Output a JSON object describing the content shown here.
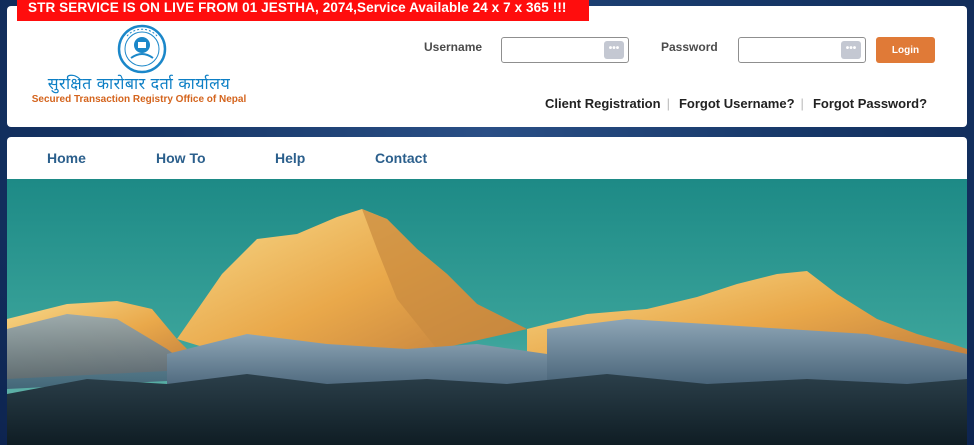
{
  "banner": {
    "text": "STR SERVICE IS ON LIVE FROM 01 JESTHA, 2074,Service Available 24 x 7 x 365 !!!"
  },
  "logo": {
    "name_np": "सुरक्षित कारोबार दर्ता कार्यालय",
    "name_en": "Secured Transaction Registry Office of Nepal",
    "icon": "office-emblem-icon"
  },
  "login": {
    "username_label": "Username",
    "password_label": "Password",
    "username_value": "",
    "password_value": "",
    "key_icon": "•••",
    "login_button": "Login"
  },
  "header_links": {
    "client_registration": "Client Registration",
    "forgot_username": "Forgot Username?",
    "forgot_password": "Forgot Password?",
    "separator": "|"
  },
  "nav": {
    "home": "Home",
    "how_to": "How To",
    "help": "Help",
    "contact": "Contact"
  },
  "hero": {
    "image": "himalayan-mountain-sunrise"
  },
  "colors": {
    "banner_red": "#ff0d0d",
    "login_orange": "#e07a37",
    "nav_blue": "#2b5f8c",
    "logo_blue": "#0d7fc5",
    "logo_orange": "#d4641d",
    "background_navy": "#173869"
  }
}
